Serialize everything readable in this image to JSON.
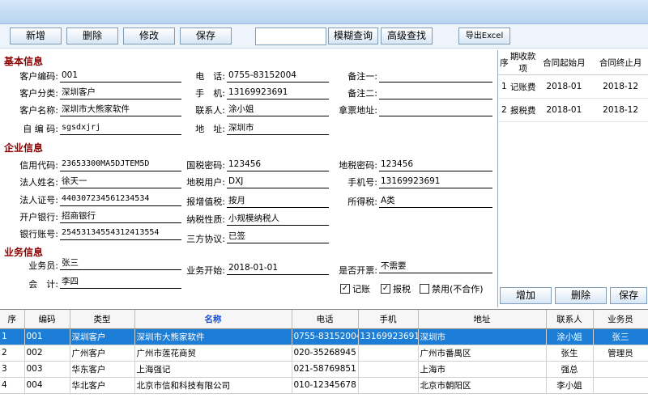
{
  "toolbar": {
    "add": "新增",
    "delete": "删除",
    "edit": "修改",
    "save": "保存",
    "search_value": "",
    "fuzzy": "模糊查询",
    "advanced": "高级查找",
    "export": "导出Excel"
  },
  "basic": {
    "title": "基本信息",
    "code_label": "客户编码:",
    "code": "001",
    "category_label": "客户分类:",
    "category": "深圳客户",
    "name_label": "客户名称:",
    "name": "深圳市大熊家软件",
    "selfcode_label": "自 编 码:",
    "selfcode": "sgsdxjrj",
    "phone_label": "电　话:",
    "phone": "0755-83152004",
    "mobile_label": "手　机:",
    "mobile": "13169923691",
    "contact_label": "联系人:",
    "contact": "涂小姐",
    "address_label": "地　址:",
    "address": "深圳市",
    "note1_label": "备注一:",
    "note1": "",
    "note2_label": "备注二:",
    "note2": "",
    "ticket_label": "拿票地址:",
    "ticket": ""
  },
  "enterprise": {
    "title": "企业信息",
    "credit_label": "信用代码:",
    "credit": "23653300MA5DJTEM5D",
    "legal_label": "法人姓名:",
    "legal": "徐天一",
    "legal_id_label": "法人证号:",
    "legal_id": "440307234561234534",
    "bank_label": "开户银行:",
    "bank": "招商银行",
    "account_label": "银行账号:",
    "account": "25453134554312413554",
    "gov_pwd_label": "国税密码:",
    "gov_pwd": "123456",
    "local_user_label": "地税用户:",
    "local_user": "DXJ",
    "vat_label": "报增值税:",
    "vat": "按月",
    "tax_nature_label": "纳税性质:",
    "tax_nature": "小规模纳税人",
    "agreement_label": "三方协议:",
    "agreement": "已签",
    "local_pwd_label": "地税密码:",
    "local_pwd": "123456",
    "phone_label": "手机号:",
    "phone": "13169923691",
    "income_tax_label": "所得税:",
    "income_tax": "A类"
  },
  "business": {
    "title": "业务信息",
    "salesman_label": "业务员:",
    "salesman": "张三",
    "accountant_label": "会　计:",
    "accountant": "李四",
    "start_label": "业务开始:",
    "start": "2018-01-01",
    "invoice_label": "是否开票:",
    "invoice": "不需要",
    "chk_bookkeeping": "记账",
    "chk_tax": "报税",
    "chk_disable": "禁用(不合作)"
  },
  "fee": {
    "headers": [
      "序",
      "期收款项",
      "合同起始月",
      "合同终止月"
    ],
    "rows": [
      [
        "1",
        "记账费",
        "2018-01",
        "2018-12"
      ],
      [
        "2",
        "报税费",
        "2018-01",
        "2018-12"
      ]
    ],
    "add": "增加",
    "delete": "删除",
    "save": "保存"
  },
  "grid": {
    "headers": [
      "序",
      "编码",
      "类型",
      "名称",
      "电话",
      "手机",
      "地址",
      "联系人",
      "业务员"
    ],
    "rows": [
      [
        "1",
        "001",
        "深圳客户",
        "深圳市大熊家软件",
        "0755-83152004",
        "13169923691",
        "深圳市",
        "涂小姐",
        "张三"
      ],
      [
        "2",
        "002",
        "广州客户",
        "广州市莲花商贸",
        "020-35268945",
        "",
        "广州市番禺区",
        "张生",
        "管理员"
      ],
      [
        "3",
        "003",
        "华东客户",
        "上海强记",
        "021-58769851",
        "",
        "上海市",
        "强总",
        ""
      ],
      [
        "4",
        "004",
        "华北客户",
        "北京市信和科技有限公司",
        "010-12345678",
        "",
        "北京市朝阳区",
        "李小姐",
        ""
      ]
    ]
  }
}
